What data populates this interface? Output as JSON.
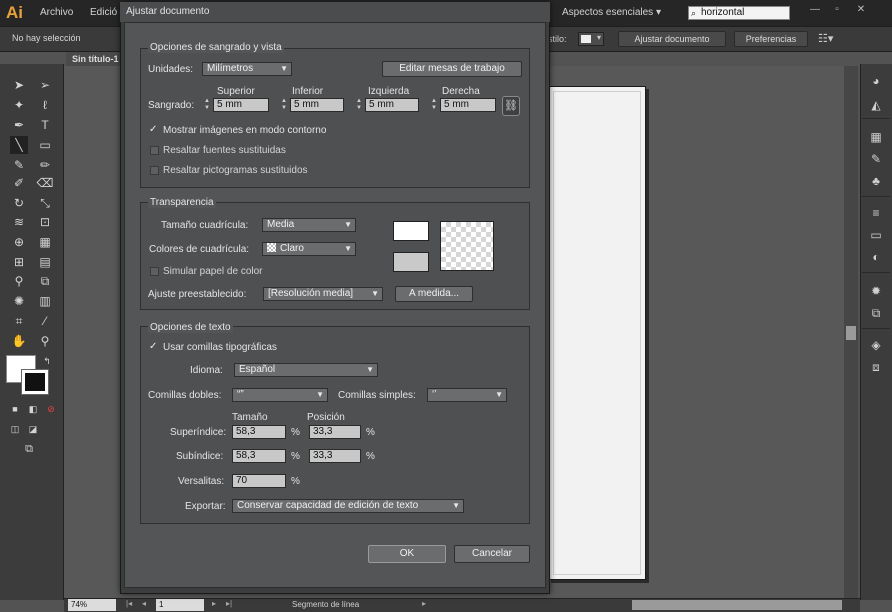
{
  "app": {
    "logo": "Ai",
    "menu": [
      "Archivo",
      "Edició"
    ],
    "workspace": "Aspectos esenciales",
    "search_value": "horizontal"
  },
  "controlbar": {
    "selection": "No hay selección",
    "style_label": "stilo:",
    "buttons": [
      "Ajustar documento",
      "Preferencias"
    ]
  },
  "document_tab": "Sin título-1",
  "dialog": {
    "title": "Ajustar documento",
    "bleed_view": {
      "title": "Opciones de sangrado y vista",
      "units_label": "Unidades:",
      "units_value": "Milímetros",
      "edit_artboards": "Editar mesas de trabajo",
      "bleed_label": "Sangrado:",
      "bleed": [
        {
          "label": "Superior",
          "value": "5 mm"
        },
        {
          "label": "Inferior",
          "value": "5 mm"
        },
        {
          "label": "Izquierda",
          "value": "5 mm"
        },
        {
          "label": "Derecha",
          "value": "5 mm"
        }
      ],
      "options": [
        {
          "label": "Mostrar imágenes en modo contorno",
          "checked": true
        },
        {
          "label": "Resaltar fuentes sustituidas",
          "checked": false
        },
        {
          "label": "Resaltar pictogramas sustituidos",
          "checked": false
        }
      ]
    },
    "transparency": {
      "title": "Transparencia",
      "grid_size_label": "Tamaño cuadrícula:",
      "grid_size_value": "Media",
      "grid_colors_label": "Colores de cuadrícula:",
      "grid_colors_value": "Claro",
      "simulate_paper": "Simular papel de color",
      "preset_label": "Ajuste preestablecido:",
      "preset_value": "[Resolución media]",
      "custom_button": "A medida..."
    },
    "text_options": {
      "title": "Opciones de texto",
      "typo_quotes": "Usar comillas tipográficas",
      "language_label": "Idioma:",
      "language_value": "Español",
      "double_quotes_label": "Comillas dobles:",
      "double_quotes_value": "“”",
      "single_quotes_label": "Comillas simples:",
      "single_quotes_value": "‘’",
      "size_header": "Tamaño",
      "position_header": "Posición",
      "superscript_label": "Superíndice:",
      "superscript_size": "58,3",
      "superscript_position": "33,3",
      "subscript_label": "Subíndice:",
      "subscript_size": "58,3",
      "subscript_position": "33,3",
      "smallcaps_label": "Versalitas:",
      "smallcaps_value": "70",
      "percent": "%",
      "export_label": "Exportar:",
      "export_value": "Conservar capacidad de edición de texto"
    },
    "ok": "OK",
    "cancel": "Cancelar"
  },
  "status": {
    "zoom": "74%",
    "page": "1",
    "tool_text": "Segmento de línea"
  }
}
